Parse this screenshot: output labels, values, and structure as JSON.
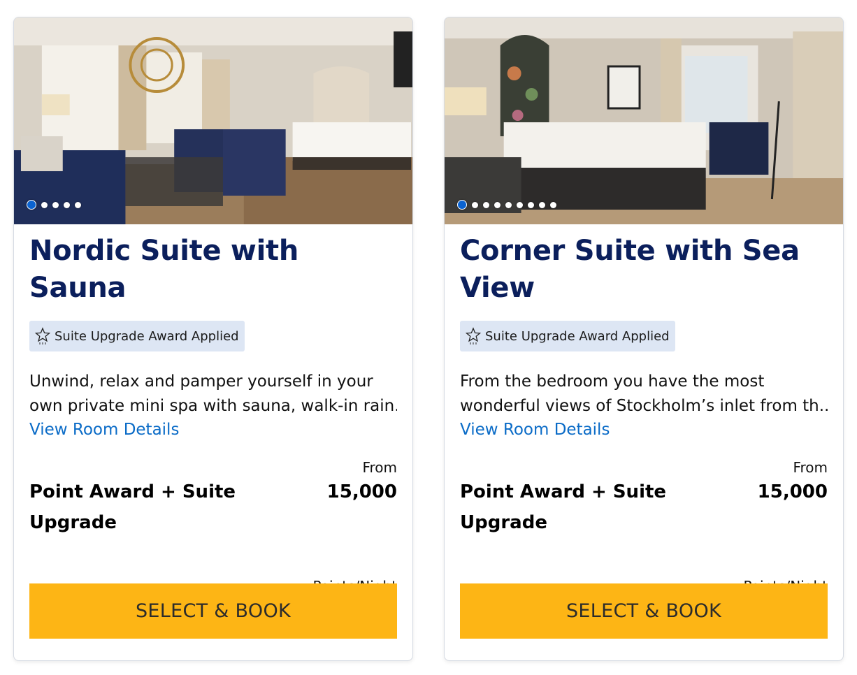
{
  "rooms": [
    {
      "title": "Nordic Suite with Sauna",
      "badge": "Suite Upgrade Award Applied",
      "description_line1": "Unwind, relax and pamper yourself in your",
      "description_line2": "own private mini spa with sauna, walk-in rain...",
      "details_link": "View Room Details",
      "rate_name": "Point Award + Suite Upgrade",
      "from_label": "From",
      "price": "15,000",
      "per_label": "Points/Night",
      "book_label": "SELECT & BOOK",
      "photo_count": 5,
      "active_photo": 1
    },
    {
      "title": "Corner Suite with Sea View",
      "badge": "Suite Upgrade Award Applied",
      "description_line1": "From the bedroom you have the most",
      "description_line2": "wonderful views of Stockholm’s inlet from th...",
      "details_link": "View Room Details",
      "rate_name": "Point Award + Suite Upgrade",
      "from_label": "From",
      "price": "15,000",
      "per_label": "Points/Night",
      "book_label": "SELECT & BOOK",
      "photo_count": 9,
      "active_photo": 1
    }
  ],
  "colors": {
    "title": "#0b1f5c",
    "link": "#0a6bc7",
    "badge_bg": "#dde6f4",
    "button": "#fdb515",
    "dot_active": "#0b63d1"
  },
  "icons": {
    "badge": "star-icon"
  }
}
